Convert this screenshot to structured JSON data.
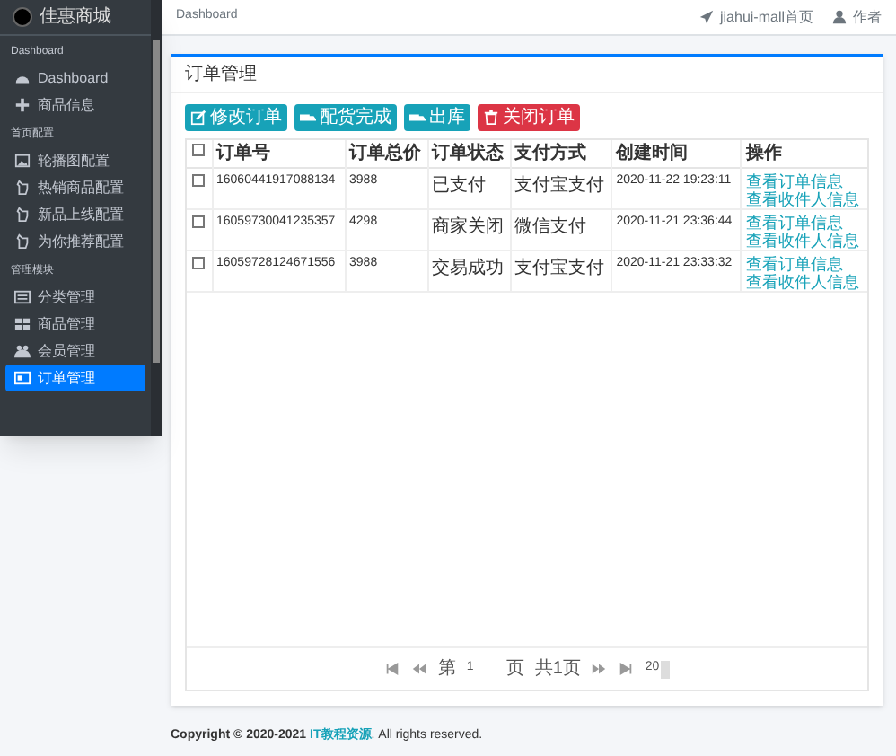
{
  "sidebar": {
    "brand": "佳惠商城",
    "sections": [
      {
        "header": "Dashboard",
        "items": [
          {
            "label": "Dashboard",
            "selected": false
          },
          {
            "label": "商品信息",
            "selected": false
          }
        ]
      },
      {
        "header": "首页配置",
        "items": [
          {
            "label": "轮播图配置",
            "selected": false
          },
          {
            "label": "热销商品配置",
            "selected": false
          },
          {
            "label": "新品上线配置",
            "selected": false
          },
          {
            "label": "为你推荐配置",
            "selected": false
          }
        ]
      },
      {
        "header": "管理模块",
        "items": [
          {
            "label": "分类管理",
            "selected": false
          },
          {
            "label": "商品管理",
            "selected": false
          },
          {
            "label": "会员管理",
            "selected": false
          },
          {
            "label": "订单管理",
            "selected": true
          }
        ]
      }
    ]
  },
  "header": {
    "breadcrumb": "Dashboard",
    "links": [
      {
        "label": "jiahui-mall首页"
      },
      {
        "label": "作者"
      }
    ]
  },
  "card": {
    "title": "订单管理",
    "buttons": [
      {
        "label": "修改订单",
        "kind": "info"
      },
      {
        "label": "配货完成",
        "kind": "info"
      },
      {
        "label": "出库",
        "kind": "info"
      },
      {
        "label": "关闭订单",
        "kind": "danger"
      }
    ],
    "table": {
      "select_all_checked": false,
      "columns": [
        "订单号",
        "订单总价",
        "订单状态",
        "支付方式",
        "创建时间",
        "操作"
      ],
      "rows": [
        {
          "checked": false,
          "cells": [
            "16060441917088134",
            "3988",
            "已支付",
            "支付宝支付",
            "2020-11-22 19:23:11"
          ],
          "actions": [
            "查看订单信息",
            "查看收件人信息"
          ]
        },
        {
          "checked": false,
          "cells": [
            "16059730041235357",
            "4298",
            "商家关闭",
            "微信支付",
            "2020-11-21 23:36:44"
          ],
          "actions": [
            "查看订单信息",
            "查看收件人信息"
          ]
        },
        {
          "checked": false,
          "cells": [
            "16059728124671556",
            "3988",
            "交易成功",
            "支付宝支付",
            "2020-11-21 23:33:32"
          ],
          "actions": [
            "查看订单信息",
            "查看收件人信息"
          ]
        }
      ]
    },
    "pager": {
      "before": "第",
      "page": "1",
      "after": "页",
      "total": "共1页",
      "size": "20"
    }
  },
  "footer": {
    "text": "Copyright © 2020-2021 ",
    "link": "IT教程资源",
    "rest": ". All rights reserved."
  }
}
